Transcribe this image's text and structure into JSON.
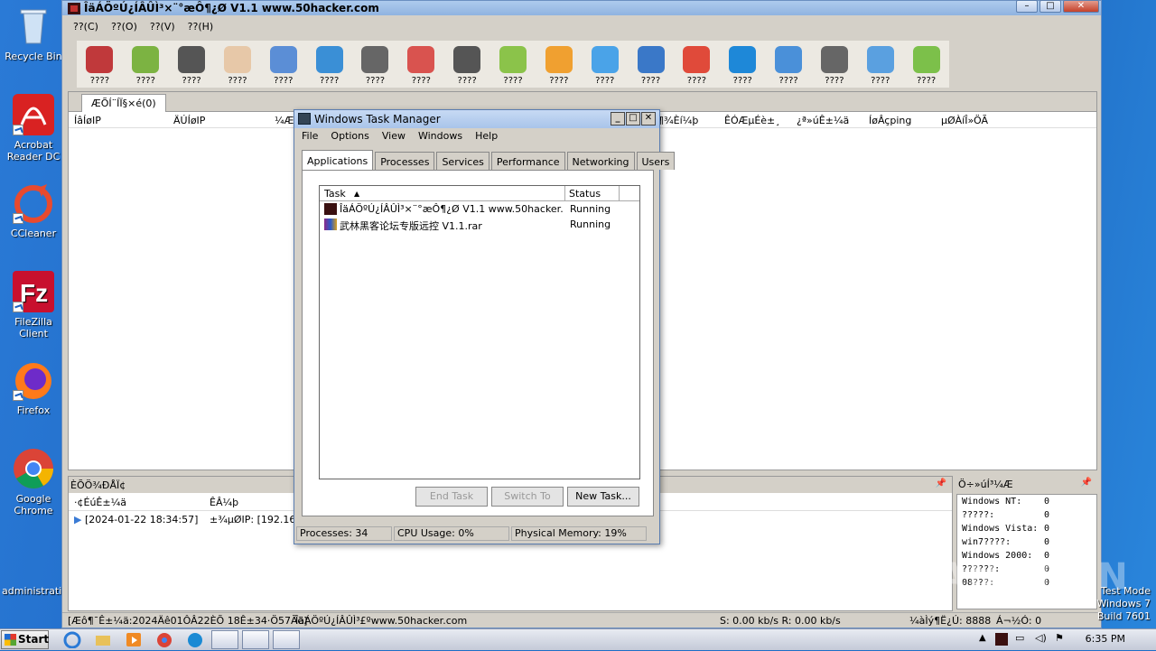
{
  "desktop": {
    "icons": [
      {
        "label": "Recycle Bin",
        "color": "#9cc0e8"
      },
      {
        "label": "Acrobat Reader DC",
        "color": "#d92222"
      },
      {
        "label": "CCleaner",
        "color": "#e84a2e"
      },
      {
        "label": "FileZilla Client",
        "color": "#c8102e"
      },
      {
        "label": "Firefox",
        "color": "#ff7a1a"
      },
      {
        "label": "Google Chrome",
        "color": "#4285f4"
      },
      {
        "label": "administrati...",
        "color": "#dddddd"
      }
    ],
    "watermark": "ANY.RUN",
    "test_mode": {
      "line1": "Test Mode",
      "line2": "Windows 7",
      "line3": "Build 7601"
    }
  },
  "app": {
    "title": "ÎäÁÖºÚ¿ÍÂÛÌ³×¨°æÔ¶¿Ø V1.1 www.50hacker.com",
    "menu": [
      "??(C)",
      "??(O)",
      "??(V)",
      "??(H)"
    ],
    "toolbar": [
      {
        "label": "????",
        "color": "#c0393b"
      },
      {
        "label": "????",
        "color": "#7cb342"
      },
      {
        "label": "????",
        "color": "#555555"
      },
      {
        "label": "????",
        "color": "#e7c8a8"
      },
      {
        "label": "????",
        "color": "#5b8ed6"
      },
      {
        "label": "????",
        "color": "#3a8fd6"
      },
      {
        "label": "????",
        "color": "#666666"
      },
      {
        "label": "????",
        "color": "#d9534f"
      },
      {
        "label": "????",
        "color": "#555555"
      },
      {
        "label": "????",
        "color": "#8bc34a"
      },
      {
        "label": "????",
        "color": "#f0a030"
      },
      {
        "label": "????",
        "color": "#4aa3e8"
      },
      {
        "label": "????",
        "color": "#3a78c8"
      },
      {
        "label": "????",
        "color": "#e04a3a"
      },
      {
        "label": "????",
        "color": "#1e88d8"
      },
      {
        "label": "????",
        "color": "#4a90d9"
      },
      {
        "label": "????",
        "color": "#666666"
      },
      {
        "label": "????",
        "color": "#5aa0e0"
      },
      {
        "label": "????",
        "color": "#7cc04a"
      }
    ],
    "tab_label": "ÆÕÍ¨ÍÏ§×é(0)",
    "columns": [
      "ÍâÍøIP",
      "ÄÚÍøIP",
      "¼ÆËã",
      "¶¾Èí¼þ",
      "ÊÓÆµÉè±¸",
      "¿ª»úÊ±¼ä",
      "ÍøÂçping",
      "µØÀíÎ»ÖÃ"
    ],
    "log_title": "ÈÕÖ¾ÐÅÏ¢",
    "log_columns": [
      "·¢ÉúÊ±¼ä",
      "ÊÂ¼þ"
    ],
    "log_rows": [
      {
        "time": "[2024-01-22 18:34:57]",
        "event": "±¾µØIP: [192.168"
      }
    ],
    "os_title": "Ö÷»úÍ³¼Æ",
    "os_stats": [
      {
        "name": "Windows NT:",
        "count": "0"
      },
      {
        "name": "?????:",
        "count": "0"
      },
      {
        "name": "Windows Vista:",
        "count": "0"
      },
      {
        "name": "win7????:",
        "count": "0"
      },
      {
        "name": "Windows 2000:",
        "count": "0"
      },
      {
        "name": "??????:",
        "count": "0"
      },
      {
        "name": "08???:",
        "count": "0"
      }
    ],
    "status": {
      "left": "[Æô¶¯Ê±¼ä:2024Äê01ÔÂ22ÈÕ 18Ê±34·Ö57Ãë]",
      "site": "ÎäÁÖºÚ¿ÍÂÛÌ³£ºwww.50hacker.com",
      "speed": "S: 0.00 kb/s R: 0.00 kb/s",
      "port": "¼àÌý¶Ë¿Ú: 8888",
      "online": "Á¬½Ó: 0"
    }
  },
  "taskmgr": {
    "title": "Windows Task Manager",
    "menu": [
      "File",
      "Options",
      "View",
      "Windows",
      "Help"
    ],
    "tabs": [
      "Applications",
      "Processes",
      "Services",
      "Performance",
      "Networking",
      "Users"
    ],
    "active_tab": "Applications",
    "col_task": "Task",
    "col_status": "Status",
    "rows": [
      {
        "name": "ÎäÁÖºÚ¿ÍÂÛÌ³×¨°æÔ¶¿Ø V1.1 www.50hacker.c...",
        "status": "Running"
      },
      {
        "name": "武林黑客论坛专版远控 V1.1.rar",
        "status": "Running"
      }
    ],
    "buttons": {
      "end_task": "End Task",
      "switch_to": "Switch To",
      "new_task": "New Task..."
    },
    "status": {
      "processes": "Processes: 34",
      "cpu": "CPU Usage: 0%",
      "memory": "Physical Memory: 19%"
    }
  },
  "taskbar": {
    "start": "Start",
    "clock": "6:35 PM"
  }
}
